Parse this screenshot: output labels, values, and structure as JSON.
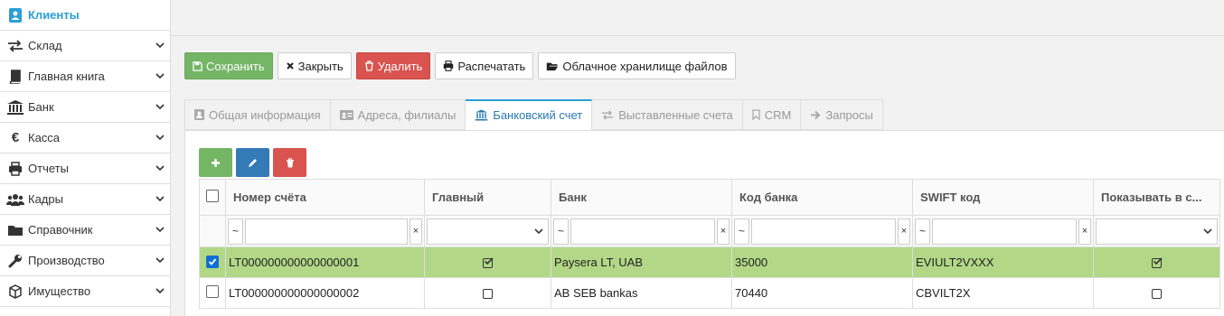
{
  "sidebar": {
    "items": [
      {
        "label": "Клиенты",
        "icon": "address-book-icon",
        "active": true
      },
      {
        "label": "Склад",
        "icon": "exchange-icon"
      },
      {
        "label": "Главная книга",
        "icon": "book-icon"
      },
      {
        "label": "Банк",
        "icon": "bank-icon"
      },
      {
        "label": "Касса",
        "icon": "euro-icon"
      },
      {
        "label": "Отчеты",
        "icon": "print-icon"
      },
      {
        "label": "Кадры",
        "icon": "users-icon"
      },
      {
        "label": "Справочник",
        "icon": "folder-icon"
      },
      {
        "label": "Производство",
        "icon": "wrench-icon"
      },
      {
        "label": "Имущество",
        "icon": "cube-icon"
      }
    ]
  },
  "toolbar": {
    "save": "Сохранить",
    "close": "Закрыть",
    "delete": "Удалить",
    "print": "Распечатать",
    "cloud": "Облачное хранилище файлов"
  },
  "tabs": [
    {
      "label": "Общая информация",
      "icon": "user-card-icon"
    },
    {
      "label": "Адреса, филиалы",
      "icon": "id-card-icon"
    },
    {
      "label": "Банковский счет",
      "icon": "bank-icon",
      "active": true
    },
    {
      "label": "Выставленные счета",
      "icon": "exchange-icon"
    },
    {
      "label": "CRM",
      "icon": "bookmark-icon"
    },
    {
      "label": "Запросы",
      "icon": "arrow-right-icon"
    }
  ],
  "grid": {
    "columns": [
      "Номер счёта",
      "Главный",
      "Банк",
      "Код банка",
      "SWIFT код",
      "Показывать в с..."
    ],
    "filter_op": "~",
    "filter_clear": "×",
    "rows": [
      {
        "account": "LT000000000000000001",
        "main": true,
        "bank": "Paysera LT, UAB",
        "code": "35000",
        "swift": "EVIULT2VXXX",
        "show": true,
        "selected": true
      },
      {
        "account": "LT000000000000000002",
        "main": false,
        "bank": "AB SEB bankas",
        "code": "70440",
        "swift": "CBVILT2X",
        "show": false,
        "selected": false
      }
    ]
  },
  "colors": {
    "green": "#74b566",
    "red": "#d9534f",
    "blue": "#337ab7",
    "accent": "#2a9fd6",
    "selected_row": "#b2d887"
  }
}
